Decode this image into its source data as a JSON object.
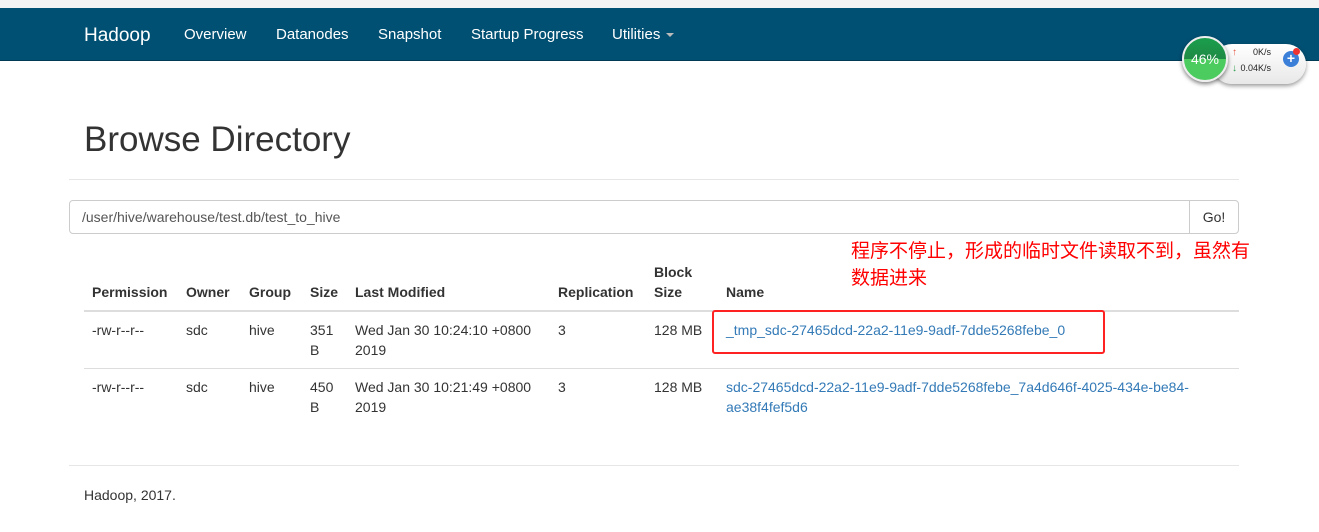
{
  "navbar": {
    "brand": "Hadoop",
    "items": [
      "Overview",
      "Datanodes",
      "Snapshot",
      "Startup Progress",
      "Utilities"
    ]
  },
  "page_title": "Browse Directory",
  "path": {
    "value": "/user/hive/warehouse/test.db/test_to_hive",
    "go_label": "Go!"
  },
  "table": {
    "headers": [
      "Permission",
      "Owner",
      "Group",
      "Size",
      "Last Modified",
      "Replication",
      "Block Size",
      "Name"
    ],
    "rows": [
      [
        "-rw-r--r--",
        "sdc",
        "hive",
        "351 B",
        "Wed Jan 30 10:24:10 +0800 2019",
        "3",
        "128 MB",
        "_tmp_sdc-27465dcd-22a2-11e9-9adf-7dde5268febe_0"
      ],
      [
        "-rw-r--r--",
        "sdc",
        "hive",
        "450 B",
        "Wed Jan 30 10:21:49 +0800 2019",
        "3",
        "128 MB",
        "sdc-27465dcd-22a2-11e9-9adf-7dde5268febe_7a4d646f-4025-434e-be84-ae38f4fef5d6"
      ]
    ]
  },
  "annotation": "程序不停止，形成的临时文件读取不到，虽然有数据进来",
  "footer": "Hadoop, 2017.",
  "net_widget": {
    "percent": "46%",
    "up": "0K/s",
    "down": "0.04K/s"
  },
  "colors": {
    "navbar": "#005073",
    "link": "#337ab7",
    "annotation": "#ff0000"
  }
}
